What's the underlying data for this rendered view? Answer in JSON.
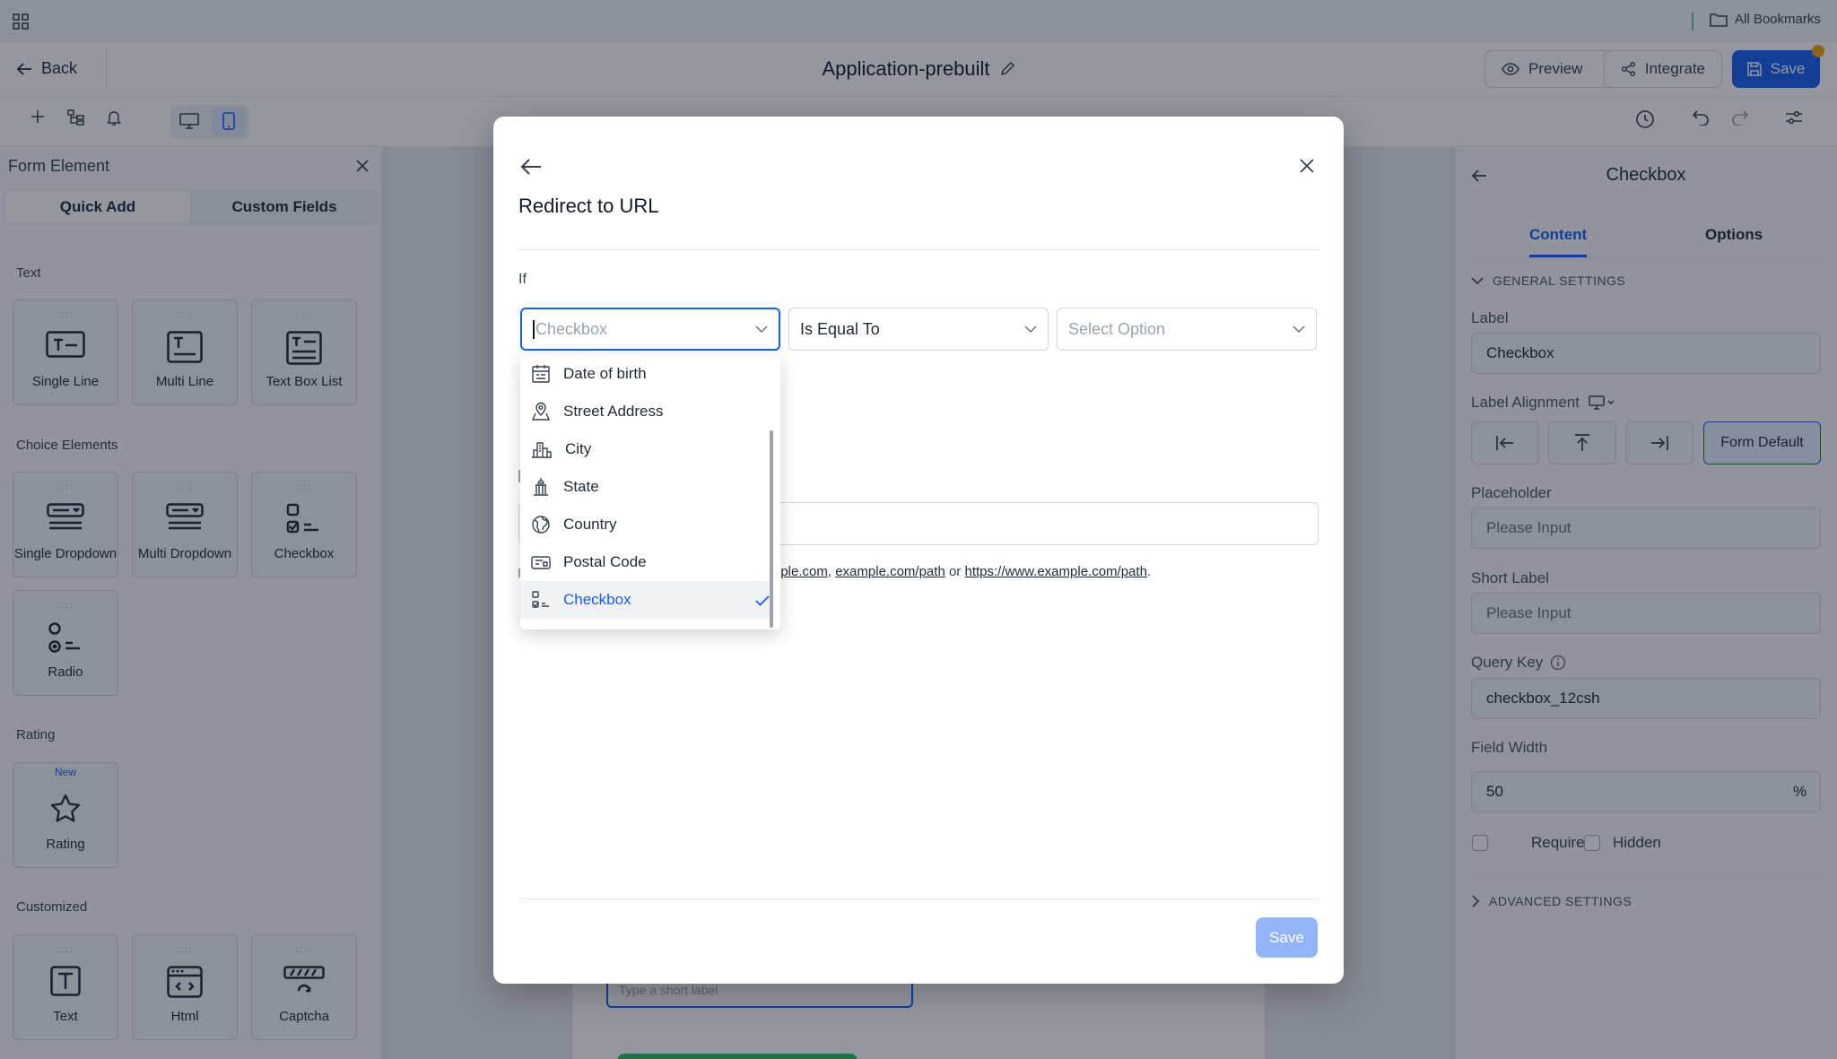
{
  "bookmarks": {
    "all_label": "All Bookmarks"
  },
  "header": {
    "back_label": "Back",
    "title": "Application-prebuilt",
    "preview_label": "Preview",
    "integrate_label": "Integrate",
    "save_label": "Save"
  },
  "left_panel": {
    "title": "Form Element",
    "tabs": [
      "Quick Add",
      "Custom Fields"
    ],
    "active_tab": "Quick Add",
    "sections": [
      {
        "title": "Text",
        "items": [
          {
            "label": "Single Line",
            "icon": "single-line-icon"
          },
          {
            "label": "Multi Line",
            "icon": "multi-line-icon"
          },
          {
            "label": "Text Box List",
            "icon": "text-box-list-icon"
          }
        ]
      },
      {
        "title": "Choice Elements",
        "items": [
          {
            "label": "Single Dropdown",
            "icon": "single-dropdown-icon"
          },
          {
            "label": "Multi Dropdown",
            "icon": "multi-dropdown-icon"
          },
          {
            "label": "Checkbox",
            "icon": "checkbox-list-icon"
          },
          {
            "label": "Radio",
            "icon": "radio-list-icon"
          }
        ]
      },
      {
        "title": "Rating",
        "items": [
          {
            "label": "Rating",
            "icon": "star-icon",
            "badge": "New"
          }
        ]
      },
      {
        "title": "Customized",
        "items": [
          {
            "label": "Text",
            "icon": "text-block-icon"
          },
          {
            "label": "Html",
            "icon": "html-icon"
          },
          {
            "label": "Captcha",
            "icon": "captcha-icon"
          }
        ]
      }
    ]
  },
  "canvas": {
    "short_label_placeholder": "Type a short label"
  },
  "right_panel": {
    "title": "Checkbox",
    "tabs": [
      "Content",
      "Options"
    ],
    "active_tab": "Content",
    "general_settings": "GENERAL SETTINGS",
    "label_label": "Label",
    "label_value": "Checkbox",
    "label_alignment": "Label Alignment",
    "alignment_default": "Form Default",
    "placeholder_label": "Placeholder",
    "placeholder_value": "Please Input",
    "short_label_label": "Short Label",
    "short_label_value": "Please Input",
    "query_key_label": "Query Key",
    "query_key_value": "checkbox_12csh",
    "field_width_label": "Field Width",
    "field_width_value": "50",
    "field_width_unit": "%",
    "required_label": "Required",
    "hidden_label": "Hidden",
    "advanced_settings": "ADVANCED SETTINGS"
  },
  "modal": {
    "title": "Redirect to URL",
    "if_label": "If",
    "field_select": {
      "placeholder": "Checkbox"
    },
    "operator_select": {
      "value": "Is Equal To"
    },
    "option_select": {
      "placeholder": "Select Option"
    },
    "hint_prefix": "",
    "hint_link1": "nple.com",
    "hint_sep1": ", ",
    "hint_link2": "example.com/path",
    "hint_or": " or ",
    "hint_link3": "https://www.example.com/path",
    "hint_end": ".",
    "save_label": "Save"
  },
  "dropdown": {
    "items": [
      {
        "label": "Date of birth",
        "icon": "calendar-icon"
      },
      {
        "label": "Street Address",
        "icon": "map-pin-icon"
      },
      {
        "label": "City",
        "icon": "city-icon"
      },
      {
        "label": "State",
        "icon": "landmark-icon"
      },
      {
        "label": "Country",
        "icon": "globe-icon"
      },
      {
        "label": "Postal Code",
        "icon": "mailbox-icon"
      },
      {
        "label": "Checkbox",
        "icon": "checkbox-list-icon",
        "selected": true
      }
    ]
  },
  "colors": {
    "accent": "#155eef",
    "overlay": "#111827"
  }
}
